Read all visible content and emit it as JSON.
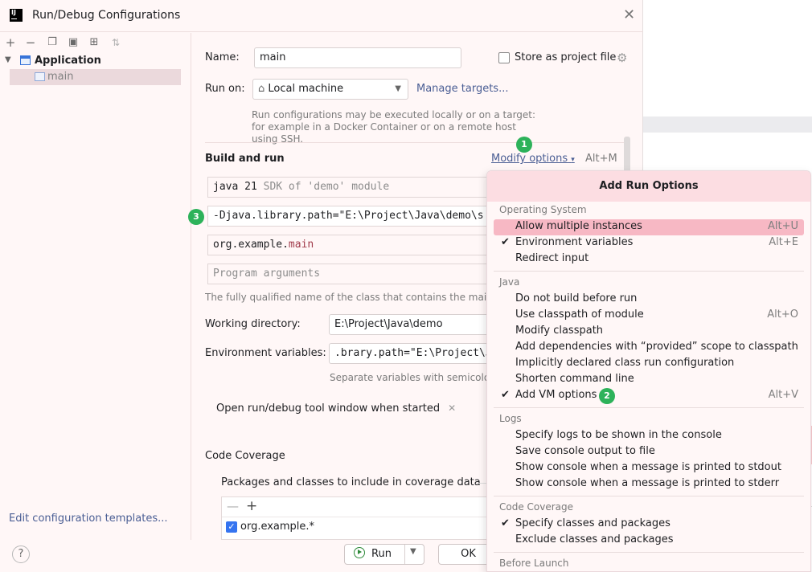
{
  "dialog": {
    "title": "Run/Debug Configurations",
    "tree": {
      "application": "Application",
      "main": "main"
    },
    "edit_templates": "Edit configuration templates..."
  },
  "form": {
    "name_label": "Name:",
    "name_value": "main",
    "store_label": "Store as project file",
    "store_checked": false,
    "runon_label": "Run on:",
    "runon_value": "Local machine",
    "manage_targets": "Manage targets...",
    "runon_hint": "Run configurations may be executed locally or on a target: for example in a Docker Container or on a remote host using SSH.",
    "build_header": "Build and run",
    "modify_options": "Modify options",
    "modify_shortcut": "Alt+M",
    "sdk_main": "java 21",
    "sdk_hint": "SDK of 'demo' module",
    "vm_options": "-Djava.library.path=\"E:\\Project\\Java\\demo\\s",
    "main_class_pkg": "org.example.",
    "main_class_name": "main",
    "args_placeholder": "Program arguments",
    "main_class_hint": "The fully qualified name of the class that contains the main met",
    "wd_label": "Working directory:",
    "wd_value": "E:\\Project\\Java\\demo",
    "env_label": "Environment variables:",
    "env_value": ".brary.path=\"E:\\Project\\J",
    "env_hint": "Separate variables with semicolon:",
    "chip_label": "Open run/debug tool window when started",
    "cc_header": "Code Coverage",
    "cc_packages": "Packages and classes to include in coverage data",
    "cc_item": "org.example.*",
    "cc_item_checked": true,
    "run_label": "Run",
    "ok_label": "OK"
  },
  "badges": {
    "one": "1",
    "two": "2",
    "three": "3"
  },
  "popup": {
    "title": "Add Run Options",
    "groups": {
      "os": "Operating System",
      "java": "Java",
      "logs": "Logs",
      "coverage": "Code Coverage",
      "before": "Before Launch"
    },
    "items": [
      {
        "label": "Allow multiple instances",
        "shortcut": "Alt+U",
        "checked": false
      },
      {
        "label": "Environment variables",
        "shortcut": "Alt+E",
        "checked": true
      },
      {
        "label": "Redirect input",
        "shortcut": "",
        "checked": false
      },
      {
        "label": "Do not build before run",
        "shortcut": "",
        "checked": false
      },
      {
        "label": "Use classpath of module",
        "shortcut": "Alt+O",
        "checked": false
      },
      {
        "label": "Modify classpath",
        "shortcut": "",
        "checked": false
      },
      {
        "label": "Add dependencies with “provided” scope to classpath",
        "shortcut": "",
        "checked": false
      },
      {
        "label": "Implicitly declared class run configuration",
        "shortcut": "",
        "checked": false
      },
      {
        "label": "Shorten command line",
        "shortcut": "",
        "checked": false
      },
      {
        "label": "Add VM options",
        "shortcut": "Alt+V",
        "checked": true
      },
      {
        "label": "Specify logs to be shown in the console",
        "shortcut": "",
        "checked": false
      },
      {
        "label": "Save console output to file",
        "shortcut": "",
        "checked": false
      },
      {
        "label": "Show console when a message is printed to stdout",
        "shortcut": "",
        "checked": false
      },
      {
        "label": "Show console when a message is printed to stderr",
        "shortcut": "",
        "checked": false
      },
      {
        "label": "Specify classes and packages",
        "shortcut": "",
        "checked": true
      },
      {
        "label": "Exclude classes and packages",
        "shortcut": "",
        "checked": false
      }
    ]
  },
  "colors": {
    "accent": "#3574f0",
    "badge": "#2db25a",
    "highlight": "#f7b8c4",
    "popup_header": "#fcdde2",
    "link": "#4a5e94"
  }
}
